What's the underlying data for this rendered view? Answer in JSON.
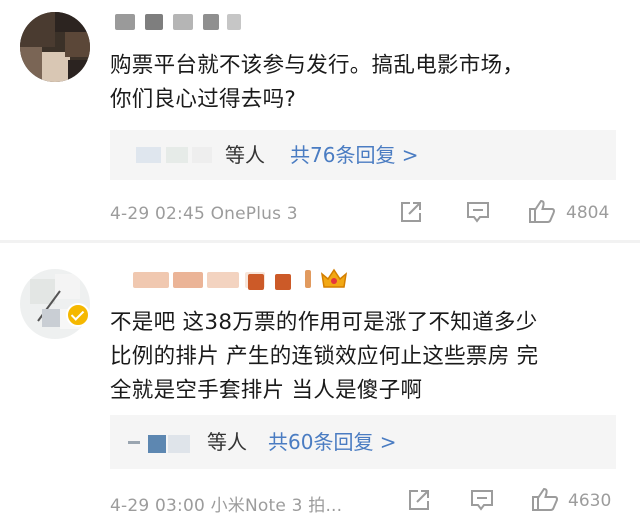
{
  "comments": [
    {
      "text": "购票平台就不该参与发行。搞乱电影市场，\n你们良心过得去吗?",
      "replies": {
        "names": "等人",
        "link": "共76条回复 >"
      },
      "meta": "4-29 02:45 OnePlus 3",
      "likes": "4804"
    },
    {
      "text": "不是吧 这38万票的作用可是涨了不知道多少\n比例的排片 产生的连锁效应何止这些票房 完\n全就是空手套排片 当人是傻子啊",
      "replies": {
        "names": "等人",
        "link": "共60条回复 >"
      },
      "meta": "4-29 03:00 小米Note 3 拍...",
      "likes": "4630"
    }
  ],
  "icons": {
    "share": "share-icon",
    "comment": "comment-icon",
    "like": "thumbs-up-icon",
    "crown": "crown-icon",
    "verified": "verified-badge-icon"
  },
  "colors": {
    "link": "#4a7cc2",
    "muted": "#9c9c9c",
    "reply_bg": "#f5f5f5",
    "badge": "#f5b800"
  }
}
